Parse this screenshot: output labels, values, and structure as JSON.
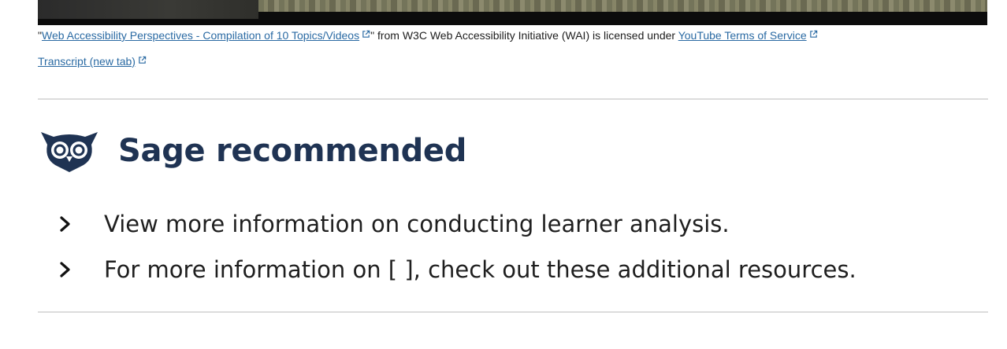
{
  "attribution": {
    "open_quote": "\"",
    "video_link": "Web Accessibility Perspectives - Compilation of 10 Topics/Videos",
    "middle_text": "\" from W3C Web Accessibility Initiative (WAI) is licensed under ",
    "license_link": "YouTube Terms of Service"
  },
  "transcript_link": "Transcript (new tab)",
  "sage": {
    "title": "Sage recommended",
    "items": [
      "View more information on conducting learner analysis.",
      "For more information on [ ], check out these additional resources."
    ]
  },
  "colors": {
    "link": "#2a6aa3",
    "heading": "#1f3353",
    "divider": "#dcdcdc"
  },
  "icons": [
    "external-link-icon",
    "owl-icon",
    "chevron-right-icon"
  ]
}
